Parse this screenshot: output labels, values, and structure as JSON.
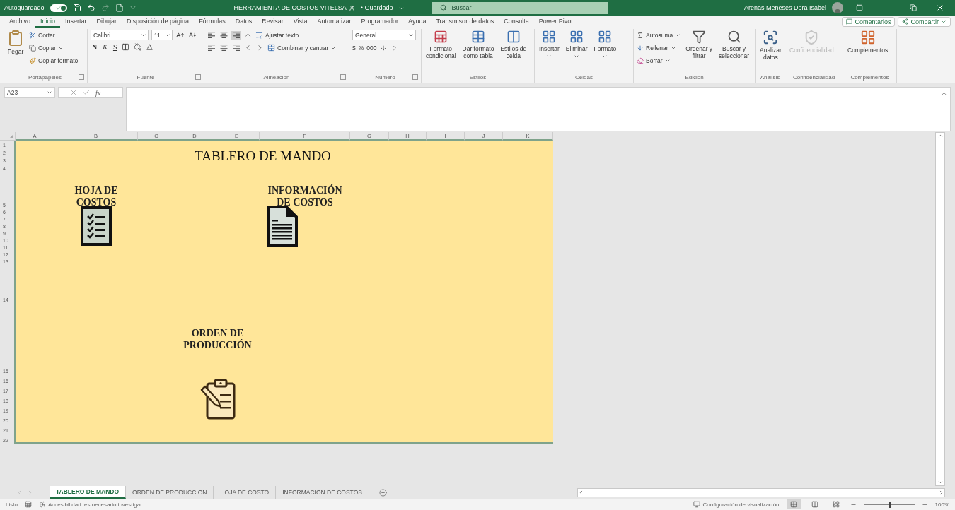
{
  "title_bar": {
    "autosave_label": "Autoguardado",
    "autosave_on": true,
    "redo_disabled": true,
    "document_title": "HERRAMIENTA DE COSTOS VITELSA",
    "saved_status": "• Guardado",
    "search_placeholder": "Buscar",
    "user_name": "Arenas Meneses Dora Isabel"
  },
  "menu_tabs": [
    {
      "label": "Archivo",
      "selected": false
    },
    {
      "label": "Inicio",
      "selected": true
    },
    {
      "label": "Insertar",
      "selected": false
    },
    {
      "label": "Dibujar",
      "selected": false
    },
    {
      "label": "Disposición de página",
      "selected": false
    },
    {
      "label": "Fórmulas",
      "selected": false
    },
    {
      "label": "Datos",
      "selected": false
    },
    {
      "label": "Revisar",
      "selected": false
    },
    {
      "label": "Vista",
      "selected": false
    },
    {
      "label": "Automatizar",
      "selected": false
    },
    {
      "label": "Programador",
      "selected": false
    },
    {
      "label": "Ayuda",
      "selected": false
    },
    {
      "label": "Transmisor de datos",
      "selected": false
    },
    {
      "label": "Consulta",
      "selected": false
    },
    {
      "label": "Power Pivot",
      "selected": false
    }
  ],
  "header_buttons": {
    "comments": "Comentarios",
    "share": "Compartir"
  },
  "ribbon": {
    "clipboard": {
      "label": "Portapapeles",
      "paste": "Pegar",
      "cut": "Cortar",
      "copy": "Copiar",
      "format_painter": "Copiar formato"
    },
    "font": {
      "label": "Fuente",
      "font_name": "Calibri",
      "font_size": "11",
      "bold": "N",
      "italic": "K",
      "underline": "S"
    },
    "alignment": {
      "label": "Alineación",
      "wrap_text": "Ajustar texto",
      "merge_center": "Combinar y centrar"
    },
    "number": {
      "label": "Número",
      "format": "General",
      "currency": "$",
      "percent": "%",
      "thousands": "000"
    },
    "styles": {
      "label": "Estilos",
      "items": [
        "Formato\ncondicional",
        "Dar formato\ncomo tabla",
        "Estilos de\ncelda"
      ]
    },
    "cells": {
      "label": "Celdas",
      "items": [
        "Insertar",
        "Eliminar",
        "Formato"
      ]
    },
    "editing": {
      "label": "Edición",
      "autosum": "Autosuma",
      "fill": "Rellenar",
      "clear": "Borrar",
      "sort_filter": "Ordenar y\nfiltrar",
      "find_select": "Buscar y\nseleccionar"
    },
    "analysis": {
      "label": "Análisis",
      "analyze": "Analizar\ndatos"
    },
    "sensitivity": {
      "label": "Confidencialidad",
      "button": "Confidencialidad",
      "disabled": true
    },
    "addins": {
      "label": "Complementos",
      "button": "Complementos"
    }
  },
  "formula_bar": {
    "name_box": "A23",
    "function_label": "fx"
  },
  "sheet": {
    "columns": [
      "A",
      "B",
      "C",
      "D",
      "E",
      "F",
      "G",
      "H",
      "I",
      "J",
      "K"
    ],
    "rows": [
      "1",
      "2",
      "3",
      "4",
      "5",
      "6",
      "7",
      "8",
      "9",
      "10",
      "11",
      "12",
      "13",
      "14",
      "15",
      "16",
      "17",
      "18",
      "19",
      "20",
      "21",
      "22"
    ],
    "title": "TABLERO DE MANDO",
    "links": [
      "HOJA DE\nCOSTOS",
      "INFORMACIÓN\nDE COSTOS",
      "ORDEN DE\nPRODUCCIÓN"
    ]
  },
  "sheet_tabs": [
    {
      "label": "TABLERO DE MANDO",
      "selected": true
    },
    {
      "label": "ORDEN DE PRODUCCION",
      "selected": false
    },
    {
      "label": "HOJA DE COSTO",
      "selected": false
    },
    {
      "label": "INFORMACION DE COSTOS",
      "selected": false
    }
  ],
  "status_bar": {
    "ready": "Listo",
    "accessibility": "Accesibilidad: es necesario investigar",
    "display_settings": "Configuración de visualización",
    "views": [
      {
        "selected": true
      },
      {
        "selected": false
      },
      {
        "selected": false
      }
    ],
    "zoom_slider": {
      "level": 0.5
    },
    "zoom": "100%"
  }
}
